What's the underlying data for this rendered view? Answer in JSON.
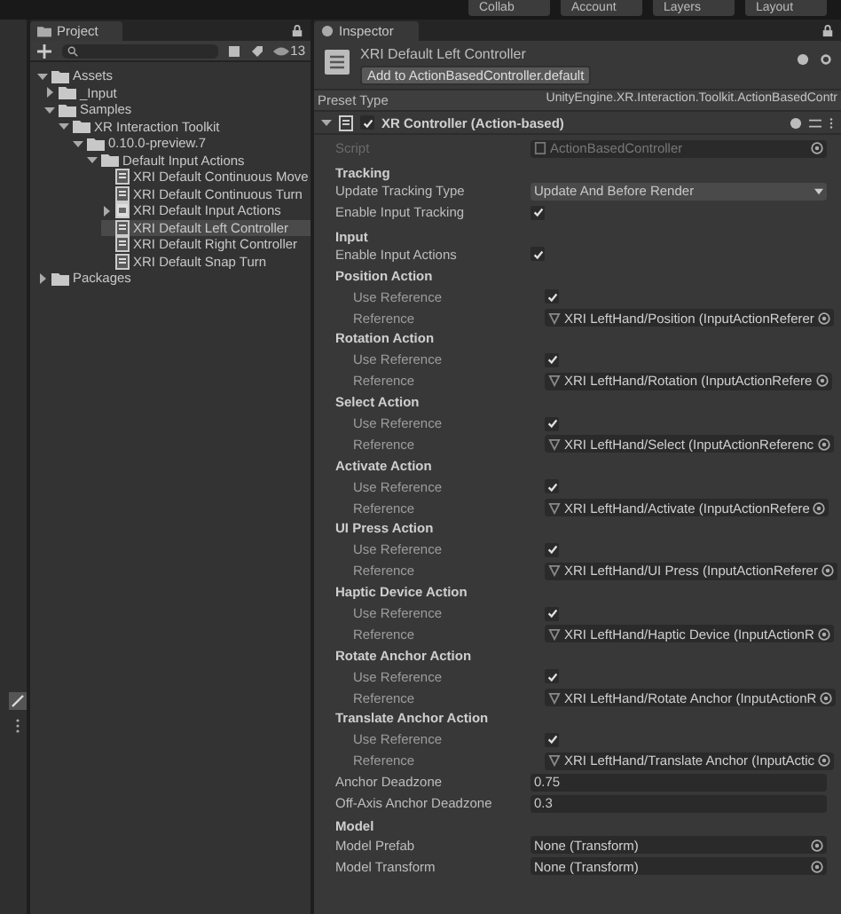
{
  "toolbar": {
    "buttons": [
      "Collab",
      "Account",
      "Layers",
      "Layout"
    ]
  },
  "project": {
    "tab": "Project",
    "hidden_count": "13",
    "tree": [
      {
        "label": "Assets",
        "kind": "folder",
        "expanded": true,
        "selected": false,
        "children": [
          {
            "label": "_Input",
            "kind": "folder",
            "expanded": false,
            "selected": false
          },
          {
            "label": "Samples",
            "kind": "folder",
            "expanded": true,
            "selected": false,
            "children": [
              {
                "label": "XR Interaction Toolkit",
                "kind": "folder",
                "expanded": true,
                "selected": false,
                "children": [
                  {
                    "label": "0.10.0-preview.7",
                    "kind": "folder",
                    "expanded": true,
                    "selected": false,
                    "children": [
                      {
                        "label": "Default Input Actions",
                        "kind": "folder",
                        "expanded": true,
                        "selected": false,
                        "children": [
                          {
                            "label": "XRI Default Continuous Move",
                            "kind": "asset",
                            "selected": false
                          },
                          {
                            "label": "XRI Default Continuous Turn",
                            "kind": "asset",
                            "selected": false
                          },
                          {
                            "label": "XRI Default Input Actions",
                            "kind": "input-asset",
                            "expanded": false,
                            "selected": false
                          },
                          {
                            "label": "XRI Default Left Controller",
                            "kind": "asset",
                            "selected": true
                          },
                          {
                            "label": "XRI Default Right Controller",
                            "kind": "asset",
                            "selected": false
                          },
                          {
                            "label": "XRI Default Snap Turn",
                            "kind": "asset",
                            "selected": false
                          }
                        ]
                      }
                    ]
                  }
                ]
              }
            ]
          }
        ]
      },
      {
        "label": "Packages",
        "kind": "folder",
        "expanded": false,
        "selected": false
      }
    ]
  },
  "inspector": {
    "tab": "Inspector",
    "asset_title": "XRI Default Left Controller",
    "add_button": "Add to ActionBasedController.default",
    "preset_type": {
      "label": "Preset Type",
      "value": "UnityEngine.XR.Interaction.Toolkit.ActionBasedContr"
    },
    "component": {
      "title": "XR Controller (Action-based)",
      "expanded": true,
      "enabled": true
    },
    "rows": [
      {
        "kind": "object",
        "label": "Script",
        "value": "ActionBasedController",
        "disabled": true
      },
      {
        "kind": "header",
        "label": "Tracking"
      },
      {
        "kind": "dropdown",
        "label": "Update Tracking Type",
        "value": "Update And Before Render"
      },
      {
        "kind": "checkbox",
        "label": "Enable Input Tracking",
        "checked": true
      },
      {
        "kind": "header",
        "label": "Input"
      },
      {
        "kind": "checkbox",
        "label": "Enable Input Actions",
        "checked": true
      },
      {
        "kind": "group",
        "label": "Position Action",
        "children": [
          {
            "kind": "checkbox",
            "label": "Use Reference",
            "checked": true
          },
          {
            "kind": "reference",
            "label": "Reference",
            "value": "XRI LeftHand/Position (InputActionReferer"
          }
        ]
      },
      {
        "kind": "group",
        "label": "Rotation Action",
        "children": [
          {
            "kind": "checkbox",
            "label": "Use Reference",
            "checked": true
          },
          {
            "kind": "reference",
            "label": "Reference",
            "value": "XRI LeftHand/Rotation (InputActionRefere"
          }
        ]
      },
      {
        "kind": "group",
        "label": "Select Action",
        "children": [
          {
            "kind": "checkbox",
            "label": "Use Reference",
            "checked": true
          },
          {
            "kind": "reference",
            "label": "Reference",
            "value": "XRI LeftHand/Select (InputActionReferenc"
          }
        ]
      },
      {
        "kind": "group",
        "label": "Activate Action",
        "children": [
          {
            "kind": "checkbox",
            "label": "Use Reference",
            "checked": true
          },
          {
            "kind": "reference",
            "label": "Reference",
            "value": "XRI LeftHand/Activate (InputActionRefere"
          }
        ]
      },
      {
        "kind": "group",
        "label": "UI Press Action",
        "children": [
          {
            "kind": "checkbox",
            "label": "Use Reference",
            "checked": true
          },
          {
            "kind": "reference",
            "label": "Reference",
            "value": "XRI LeftHand/UI Press (InputActionReferer"
          }
        ]
      },
      {
        "kind": "group",
        "label": "Haptic Device Action",
        "children": [
          {
            "kind": "checkbox",
            "label": "Use Reference",
            "checked": true
          },
          {
            "kind": "reference",
            "label": "Reference",
            "value": "XRI LeftHand/Haptic Device (InputActionR"
          }
        ]
      },
      {
        "kind": "group",
        "label": "Rotate Anchor Action",
        "children": [
          {
            "kind": "checkbox",
            "label": "Use Reference",
            "checked": true
          },
          {
            "kind": "reference",
            "label": "Reference",
            "value": "XRI LeftHand/Rotate Anchor (InputActionR"
          }
        ]
      },
      {
        "kind": "group",
        "label": "Translate Anchor Action",
        "children": [
          {
            "kind": "checkbox",
            "label": "Use Reference",
            "checked": true
          },
          {
            "kind": "reference",
            "label": "Reference",
            "value": "XRI LeftHand/Translate Anchor (InputActic"
          }
        ]
      },
      {
        "kind": "number",
        "label": "Anchor Deadzone",
        "value": "0.75"
      },
      {
        "kind": "number",
        "label": "Off-Axis Anchor Deadzone",
        "value": "0.3"
      },
      {
        "kind": "header",
        "label": "Model"
      },
      {
        "kind": "object",
        "label": "Model Prefab",
        "value": "None (Transform)",
        "disabled": false
      },
      {
        "kind": "object",
        "label": "Model Transform",
        "value": "None (Transform)",
        "disabled": false
      }
    ]
  }
}
